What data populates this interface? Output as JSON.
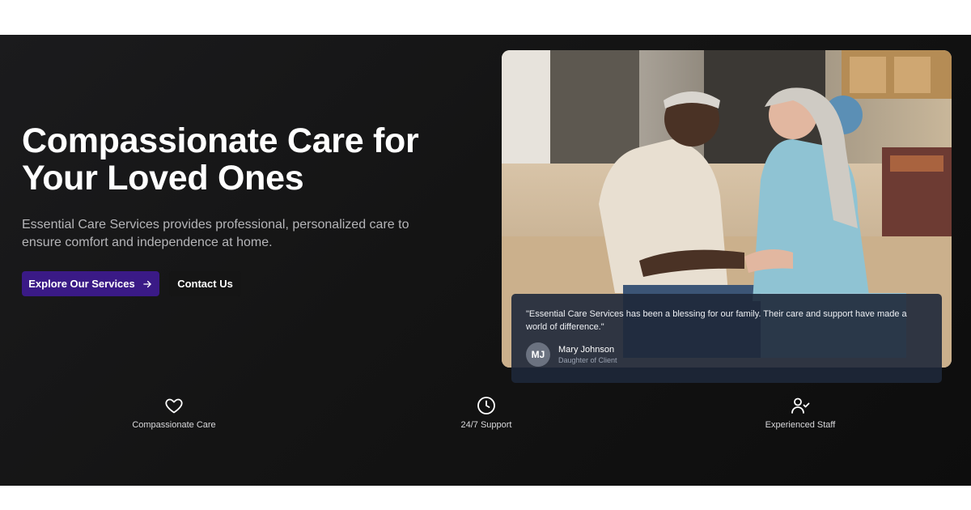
{
  "hero": {
    "headline_line1": "Compassionate Care for",
    "headline_line2": "Your Loved Ones",
    "subtext": "Essential Care Services provides professional, personalized care to ensure comfort and independence at home.",
    "primary_button": {
      "label": "Explore Our Services",
      "icon": "arrow-right-icon"
    },
    "secondary_button": {
      "label": "Contact Us"
    }
  },
  "testimonial": {
    "quote": "\"Essential Care Services has been a blessing for our family. Their care and support have made a world of difference.\"",
    "author_initials": "MJ",
    "author_name": "Mary Johnson",
    "author_role": "Daughter of Client"
  },
  "features": [
    {
      "label": "Compassionate Care",
      "icon": "heart-icon"
    },
    {
      "label": "24/7 Support",
      "icon": "clock-icon"
    },
    {
      "label": "Experienced Staff",
      "icon": "user-check-icon"
    }
  ],
  "colors": {
    "primary_button": "#3a1a86",
    "hero_background": "#141414",
    "testimonial_background": "#1e283a"
  }
}
